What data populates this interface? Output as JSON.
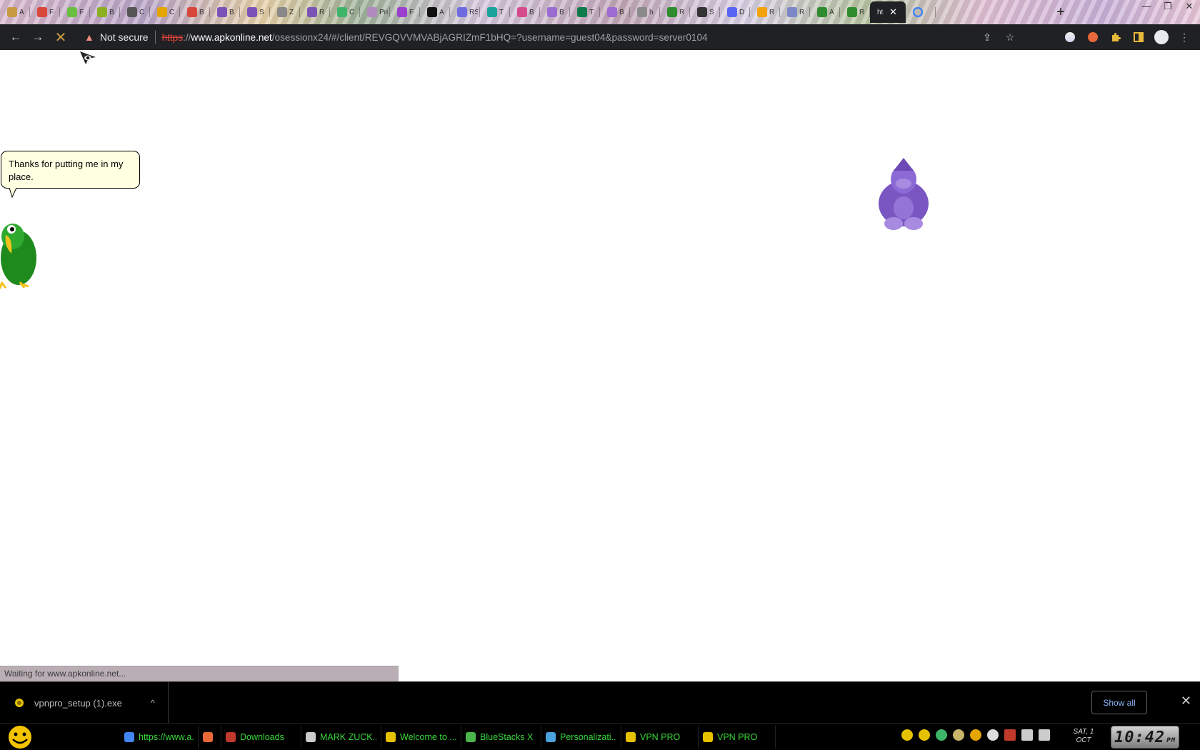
{
  "tabs": [
    {
      "label": "A",
      "color": "#c99b41"
    },
    {
      "label": "F",
      "color": "#d9463a"
    },
    {
      "label": "F",
      "color": "#6abf40"
    },
    {
      "label": "B",
      "color": "#8cb021"
    },
    {
      "label": "C",
      "color": "#555555"
    },
    {
      "label": "C",
      "color": "#e5a500"
    },
    {
      "label": "B",
      "color": "#d9463a"
    },
    {
      "label": "B",
      "color": "#7b52b8"
    },
    {
      "label": "S",
      "color": "#7b52b8"
    },
    {
      "label": "Z",
      "color": "#888888"
    },
    {
      "label": "R",
      "color": "#7b52b8"
    },
    {
      "label": "C",
      "color": "#3fb56a"
    },
    {
      "label": "Priva",
      "color": "#b08abf"
    },
    {
      "label": "F",
      "color": "#9b3fd1"
    },
    {
      "label": "A",
      "color": "#111111"
    },
    {
      "label": "RSO",
      "color": "#6e6be0"
    },
    {
      "label": "T",
      "color": "#1aa39a"
    },
    {
      "label": "B",
      "color": "#d64b8c"
    },
    {
      "label": "B",
      "color": "#9b6bd1"
    },
    {
      "label": "T",
      "color": "#0f7a4a"
    },
    {
      "label": "B",
      "color": "#9b6bd1"
    },
    {
      "label": "h",
      "color": "#8a8a8a"
    },
    {
      "label": "R",
      "color": "#2e8b2e"
    },
    {
      "label": "S",
      "color": "#333333"
    },
    {
      "label": "D",
      "color": "#5865f2"
    },
    {
      "label": "R",
      "color": "#f2a20a"
    },
    {
      "label": "R",
      "color": "#7b86c8"
    },
    {
      "label": "A",
      "color": "#2e8b2e"
    },
    {
      "label": "R",
      "color": "#2e8b2e"
    }
  ],
  "active_tab": {
    "label": "ht",
    "close": "✕"
  },
  "new_tab": "+",
  "window_controls": {
    "minimize": "—",
    "maximize": "❐",
    "close": "✕"
  },
  "toolbar": {
    "back": "←",
    "forward": "→",
    "stop": "✕",
    "warning": "▲",
    "security_label": "Not secure",
    "url_scheme": "https",
    "url_sep": "://",
    "url_host": "www.apkonline.net",
    "url_rest": "/osessionx24/#/client/REVGQVVMVABjAGRIZmF1bHQ=?username=guest04&password=server0104",
    "share": "⇪",
    "bookmark": "☆",
    "menu": "⋮"
  },
  "content": {
    "bubble_text": "Thanks for putting me in my place.",
    "status_text": "Waiting for www.apkonline.net..."
  },
  "downloads": {
    "file_name": "vpnpro_setup (1).exe",
    "chevron": "^",
    "show_all": "Show all",
    "close": "✕"
  },
  "taskbar": {
    "items": [
      {
        "label": "https://www.a...",
        "color": "#4285f4"
      },
      {
        "label": "",
        "color": "#e8683a"
      },
      {
        "label": "Downloads",
        "color": "#c0392b"
      },
      {
        "label": "MARK ZUCK...",
        "color": "#cccccc"
      },
      {
        "label": "Welcome to ...",
        "color": "#e5c100"
      },
      {
        "label": "BlueStacks X",
        "color": "#4ab54a"
      },
      {
        "label": "Personalizati...",
        "color": "#4aa3df"
      },
      {
        "label": "VPN PRO",
        "color": "#e5c100"
      },
      {
        "label": "VPN PRO",
        "color": "#e5c100"
      }
    ],
    "date": "SAT, 1 OCT",
    "time": "10:42",
    "ampm": "PM"
  }
}
